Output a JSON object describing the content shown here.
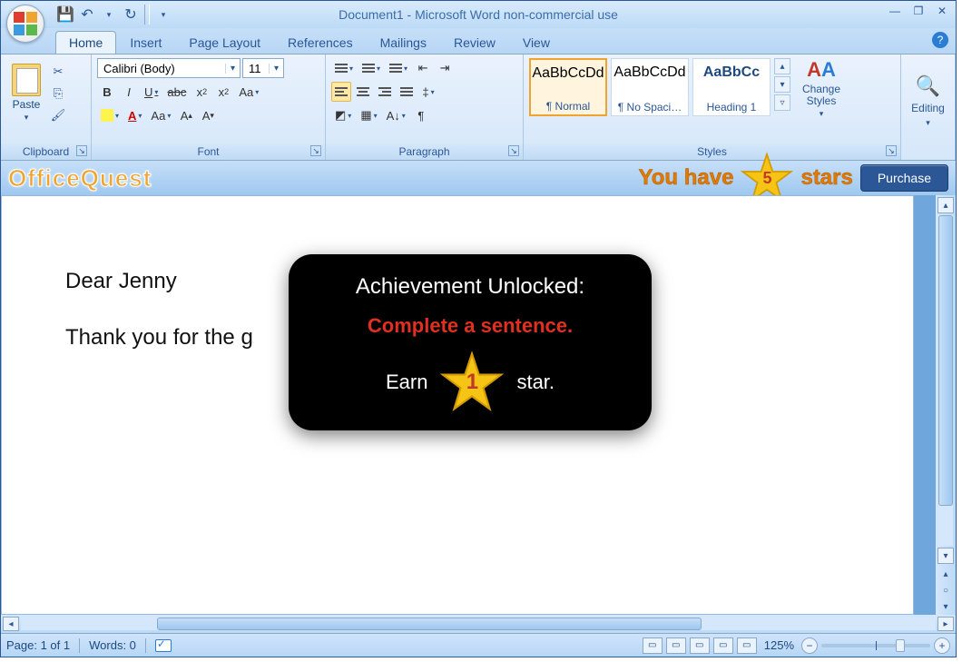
{
  "title": "Document1 - Microsoft Word non-commercial use",
  "qat": {
    "save": "save-icon",
    "undo": "undo-icon",
    "redo": "redo-icon"
  },
  "tabs": [
    "Home",
    "Insert",
    "Page Layout",
    "References",
    "Mailings",
    "Review",
    "View"
  ],
  "active_tab": 0,
  "ribbon": {
    "clipboard": {
      "label": "Clipboard",
      "paste": "Paste"
    },
    "font": {
      "label": "Font",
      "name": "Calibri (Body)",
      "size": "11"
    },
    "paragraph": {
      "label": "Paragraph"
    },
    "styles": {
      "label": "Styles",
      "tiles": [
        {
          "sample": "AaBbCcDd",
          "name": "¶ Normal",
          "selected": true,
          "color": "#000"
        },
        {
          "sample": "AaBbCcDd",
          "name": "¶ No Spaci…",
          "selected": false,
          "color": "#000"
        },
        {
          "sample": "AaBbCc",
          "name": "Heading 1",
          "selected": false,
          "color": "#1f497d"
        }
      ],
      "change": "Change Styles"
    },
    "editing": {
      "label": "Editing"
    }
  },
  "officequest": {
    "logo": "OfficeQuest",
    "you_have": "You have",
    "stars_label": "stars",
    "star_count": "5",
    "purchase": "Purchase"
  },
  "document": {
    "line1": "Dear Jenny",
    "line2": "Thank you for the g"
  },
  "achievement": {
    "heading": "Achievement Unlocked:",
    "task": "Complete a sentence.",
    "earn": "Earn",
    "star_text": "star.",
    "star_value": "1"
  },
  "status": {
    "page": "Page: 1 of 1",
    "words": "Words: 0",
    "zoom": "125%"
  }
}
